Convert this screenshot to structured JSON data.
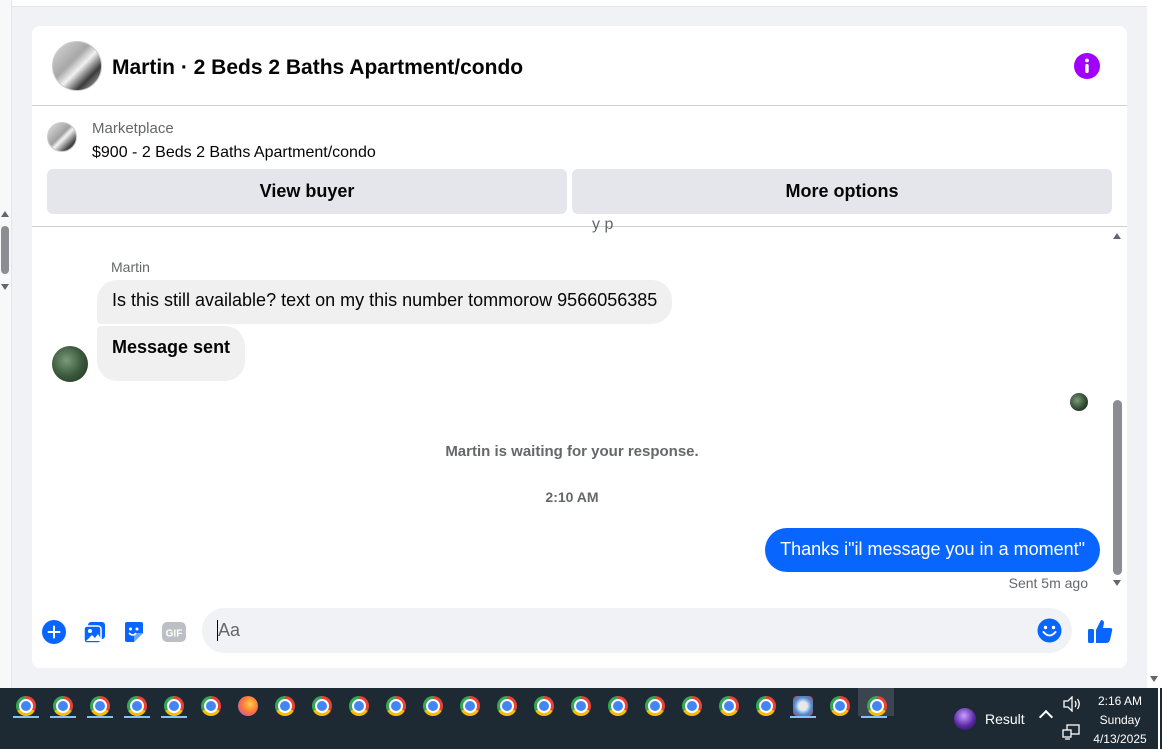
{
  "header": {
    "title": "Martin · 2 Beds 2 Baths Apartment/condo",
    "avatar_icon": "listing-photo-icon",
    "info_icon": "info-icon",
    "info_color": "#a100ff"
  },
  "marketplace": {
    "label": "Marketplace",
    "listing": "$900 - 2 Beds 2 Baths Apartment/condo",
    "view_buyer": "View buyer",
    "more_options": "More options"
  },
  "chat": {
    "cut_off_text": "y p",
    "sender_name": "Martin",
    "messages_in": [
      "Is this still available? text on my this number tommorow 9566056385",
      "Message sent"
    ],
    "waiting_notice": "Martin is waiting for your response.",
    "timestamp": "2:10 AM",
    "message_out": "Thanks i\"il message you in a moment\"",
    "sent_status": "Sent 5m ago",
    "outgoing_color": "#0866ff"
  },
  "composer": {
    "placeholder": "Aa",
    "icons": [
      "plus-icon",
      "photo-icon",
      "sticker-icon",
      "gif-icon",
      "emoji-icon",
      "thumbs-up-icon"
    ],
    "gif_label": "GIF"
  },
  "taskbar": {
    "result_label": "Result",
    "clock_time": "2:16 AM",
    "clock_day": "Sunday",
    "clock_date": "4/13/2025"
  }
}
